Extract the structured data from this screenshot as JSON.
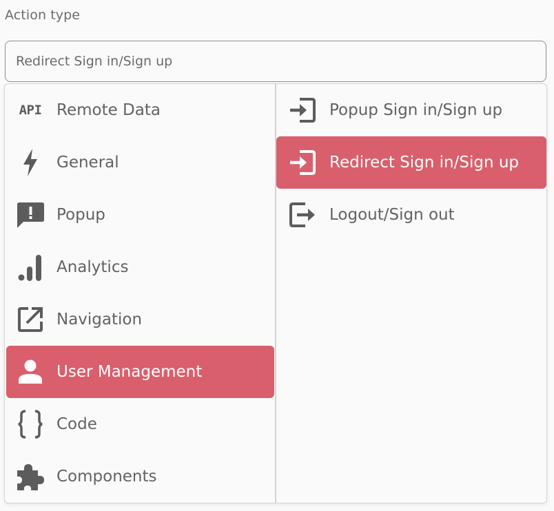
{
  "field": {
    "label": "Action type",
    "value": "Redirect Sign in/Sign up"
  },
  "categories": [
    {
      "label": "Remote Data",
      "icon": "api-icon",
      "icon_text": "API",
      "active": false
    },
    {
      "label": "General",
      "icon": "lightning-bolt-icon",
      "active": false
    },
    {
      "label": "Popup",
      "icon": "alert-message-icon",
      "active": false
    },
    {
      "label": "Analytics",
      "icon": "signal-bars-icon",
      "active": false
    },
    {
      "label": "Navigation",
      "icon": "open-in-new-icon",
      "active": false
    },
    {
      "label": "User Management",
      "icon": "person-icon",
      "active": true
    },
    {
      "label": "Code",
      "icon": "curly-braces-icon",
      "active": false
    },
    {
      "label": "Components",
      "icon": "puzzle-piece-icon",
      "active": false
    }
  ],
  "actions": [
    {
      "label": "Popup Sign in/Sign up",
      "icon": "login-icon",
      "active": false
    },
    {
      "label": "Redirect Sign in/Sign up",
      "icon": "login-icon",
      "active": true
    },
    {
      "label": "Logout/Sign out",
      "icon": "logout-icon",
      "active": false
    }
  ],
  "colors": {
    "active_background": "#d95f6c",
    "active_text": "#ffffff",
    "text": "#626262",
    "icon": "#5c5c5c"
  }
}
